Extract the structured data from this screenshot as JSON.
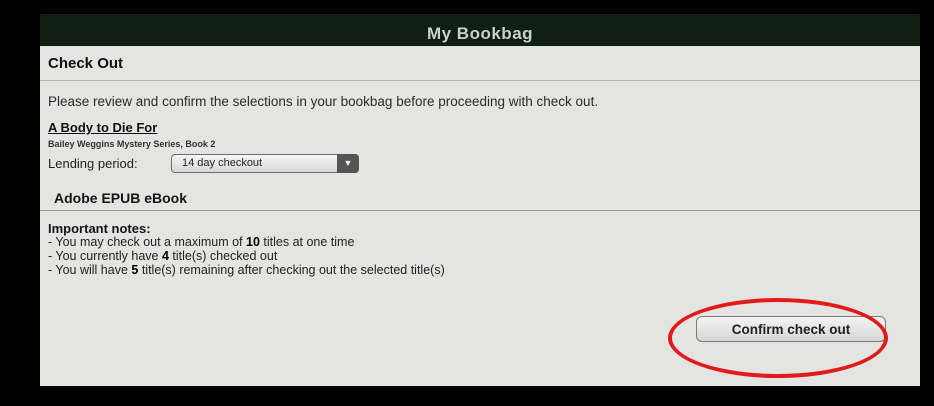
{
  "header": {
    "title": "My Bookbag"
  },
  "checkout": {
    "section_title": "Check Out",
    "instructions": "Please review and confirm the selections in your bookbag before proceeding with check out."
  },
  "item": {
    "title": "A Body to Die For",
    "series": "Bailey Weggins Mystery Series, Book 2",
    "lending_label": "Lending period:",
    "lending_value": "14 day checkout",
    "format": "Adobe EPUB eBook"
  },
  "notes": {
    "heading": "Important notes:",
    "lines": [
      {
        "prefix": "- You may check out a maximum of ",
        "value": "10",
        "suffix": " titles at one time"
      },
      {
        "prefix": "- You currently have ",
        "value": "4",
        "suffix": " title(s) checked out"
      },
      {
        "prefix": "- You will have ",
        "value": "5",
        "suffix": " title(s) remaining after checking out the selected title(s)"
      }
    ]
  },
  "actions": {
    "confirm_label": "Confirm check out"
  },
  "icons": {
    "select_arrow": "chevron-down-icon"
  },
  "colors": {
    "highlight": "#e21a1a",
    "header_bg": "#0f1f12",
    "panel_bg": "#e4e4e2"
  }
}
